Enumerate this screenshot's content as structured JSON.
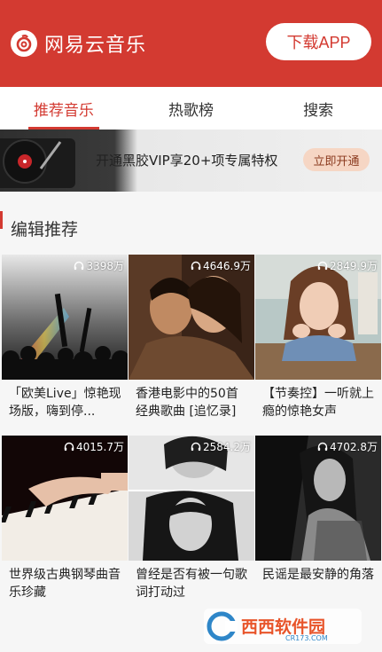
{
  "header": {
    "app_title": "网易云音乐",
    "download_label": "下载APP",
    "brand_color": "#d33a31"
  },
  "tabs": [
    {
      "label": "推荐音乐",
      "active": true
    },
    {
      "label": "热歌榜",
      "active": false
    },
    {
      "label": "搜索",
      "active": false
    }
  ],
  "banner": {
    "text": "开通黑胶VIP享20+项专属特权",
    "button_label": "立即开通"
  },
  "section": {
    "title": "编辑推荐"
  },
  "playlists": [
    {
      "plays": "3398万",
      "title": "「欧美Live」惊艳现场版，嗨到停..."
    },
    {
      "plays": "4646.9万",
      "title": "香港电影中的50首经典歌曲 [追忆录]"
    },
    {
      "plays": "2849.9万",
      "title": "【节奏控】一听就上瘾的惊艳女声"
    },
    {
      "plays": "4015.7万",
      "title": "世界级古典钢琴曲音乐珍藏"
    },
    {
      "plays": "2584.2万",
      "title": "曾经是否有被一句歌词打动过"
    },
    {
      "plays": "4702.8万",
      "title": "民谣是最安静的角落"
    }
  ],
  "watermark": {
    "text": "西西软件园",
    "subtext": "CR173.COM"
  }
}
